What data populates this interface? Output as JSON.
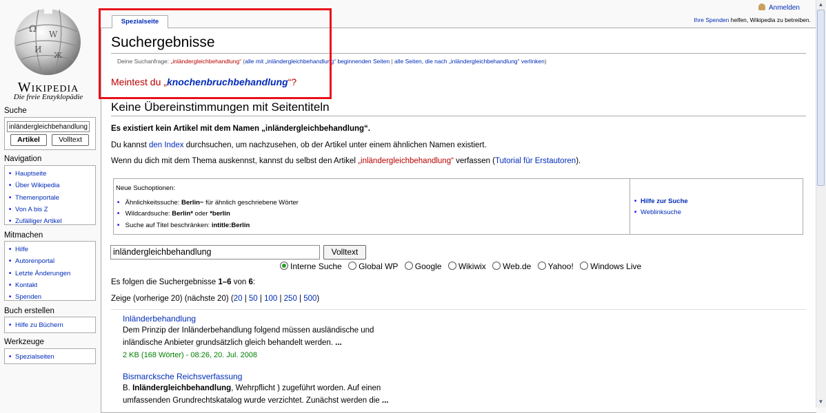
{
  "logo": {
    "wordmark": "Wikipedia",
    "tagline": "Die freie Enzyklopädie"
  },
  "sidebar": {
    "search_heading": "Suche",
    "search_value": "inländergleichbehandlung",
    "article_button": "Artikel",
    "fulltext_button": "Volltext",
    "navigation_heading": "Navigation",
    "navigation": [
      "Hauptseite",
      "Über Wikipedia",
      "Themenportale",
      "Von A bis Z",
      "Zufälliger Artikel"
    ],
    "participate_heading": "Mitmachen",
    "participate": [
      "Hilfe",
      "Autorenportal",
      "Letzte Änderungen",
      "Kontakt",
      "Spenden"
    ],
    "book_heading": "Buch erstellen",
    "book": [
      "Hilfe zu Büchern"
    ],
    "tools_heading": "Werkzeuge",
    "tools": [
      "Spezialseiten"
    ]
  },
  "top": {
    "login": "Anmelden",
    "donate_link": "Ihre Spenden",
    "donate_rest": " helfen, Wikipedia zu betreiben."
  },
  "tab": {
    "label": "Spezialseite"
  },
  "page": {
    "title": "Suchergebnisse",
    "query_prefix": "Deine Suchanfrage: ",
    "query_term": "„inländergleichbehandlung“",
    "query_link1": "alle mit „inländergleichbehandlung“ beginnenden Seiten",
    "query_link2": "alle Seiten, die nach „inländergleichbehandlung“ verlinken",
    "dym_prefix": "Meintest du „",
    "dym_term": "knochenbruchbehandlung",
    "dym_suffix": "“?",
    "section_heading": "Keine Übereinstimmungen mit Seitentiteln",
    "no_article": "Es existiert kein Artikel mit dem Namen „inländergleichbehandlung“.",
    "index_pre": "Du kannst ",
    "index_link": "den Index",
    "index_post": " durchsuchen, um nachzusehen, ob der Artikel unter einem ähnlichen Namen existiert.",
    "create_pre": "Wenn du dich mit dem Thema auskennst, kannst du selbst den Artikel ",
    "create_link": "„inländergleichbehandlung“",
    "create_mid": " verfassen (",
    "create_tut": "Tutorial für Erstautoren",
    "create_end": ")."
  },
  "options": {
    "heading": "Neue Suchoptionen:",
    "opt1_label": "Ähnlichkeitssuche: ",
    "opt1_bold": "Berlin~",
    "opt1_rest": " für ähnlich geschriebene Wörter",
    "opt2_label": "Wildcardsuche: ",
    "opt2_bold1": "Berlin*",
    "opt2_mid": " oder ",
    "opt2_bold2": "*berlin",
    "opt3_label": "Suche auf Titel beschränken: ",
    "opt3_bold": "intitle:Berlin",
    "help": "Hilfe zur Suche",
    "weblink": "Weblinksuche"
  },
  "search": {
    "value": "inländergleichbehandlung",
    "button": "Volltext",
    "engines": [
      "Interne Suche",
      "Global WP",
      "Google",
      "Wikiwix",
      "Web.de",
      "Yahoo!",
      "Windows Live"
    ],
    "selected": "Interne Suche"
  },
  "results": {
    "summary_pre": "Es folgen die Suchergebnisse ",
    "summary_range": "1–6",
    "summary_mid": " von ",
    "summary_total": "6",
    "summary_end": ":",
    "paging_pre": "Zeige (vorherige 20) (nächste 20) (",
    "page_sizes": [
      "20",
      "50",
      "100",
      "250",
      "500"
    ],
    "paging_end": ")",
    "items": [
      {
        "title": "Inländerbehandlung",
        "line1": "Dem Prinzip der Inländerbehandlung folgend müssen ausländische und",
        "line2": "inländische Anbieter grundsätzlich gleich behandelt werden. ",
        "ellipsis": "...",
        "meta": "2 KB (168 Wörter) - 08:26, 20. Jul. 2008"
      },
      {
        "title": "Bismarcksche Reichsverfassung",
        "line1_pre": "B. ",
        "line1_bold": "Inländergleichbehandlung",
        "line1_post": ", Wehrpflicht ) zugeführt worden. Auf einen",
        "line2": "umfassenden Grundrechtskatalog wurde verzichtet. Zunächst werden die ",
        "ellipsis": "..."
      }
    ]
  },
  "colors": {
    "link": "#002bb8",
    "redlink": "#ba0000",
    "highlight": "#e8101a",
    "meta": "#008000"
  }
}
